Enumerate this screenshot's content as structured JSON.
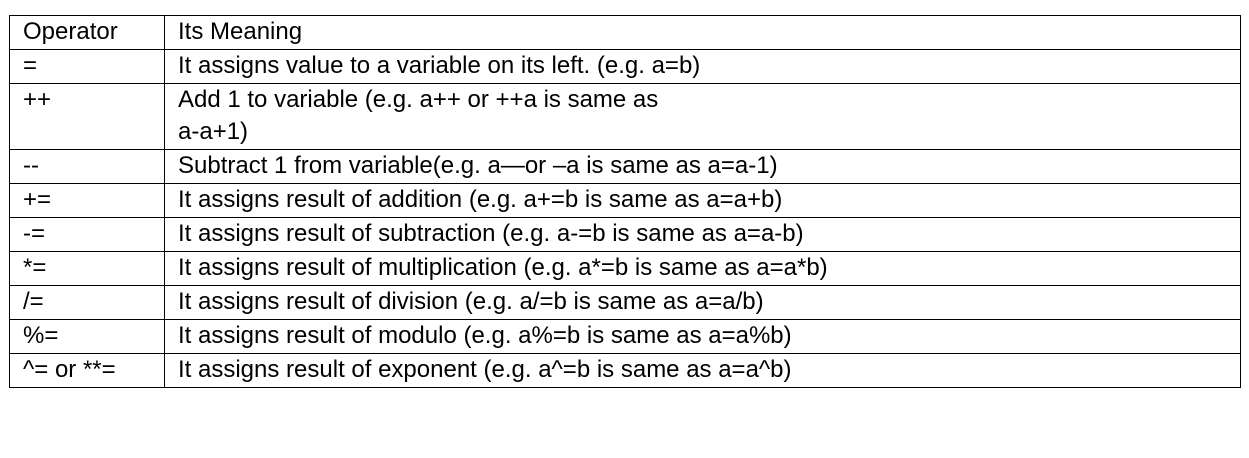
{
  "table": {
    "headers": [
      "Operator",
      "Its Meaning"
    ],
    "rows": [
      {
        "operator": "=",
        "meaning": [
          "It assigns value to a variable on its left. (e.g. a=b)"
        ]
      },
      {
        "operator": "++",
        "meaning": [
          "Add 1 to variable (e.g. a++ or ++a is same as",
          "a-a+1)"
        ]
      },
      {
        "operator": "--",
        "meaning": [
          "Subtract 1 from variable(e.g. a—or –a is same as a=a-1)"
        ]
      },
      {
        "operator": "+=",
        "meaning": [
          "It assigns result of addition (e.g. a+=b is same as a=a+b)"
        ]
      },
      {
        "operator": "-=",
        "meaning": [
          "It assigns result of subtraction (e.g. a-=b is same as a=a-b)"
        ]
      },
      {
        "operator": "*=",
        "meaning": [
          "It assigns result of multiplication (e.g. a*=b is same as a=a*b)"
        ]
      },
      {
        "operator": "/=",
        "meaning": [
          "It assigns result of division (e.g. a/=b is same as a=a/b)"
        ]
      },
      {
        "operator": "%=",
        "meaning": [
          "It assigns result of modulo (e.g. a%=b is same as a=a%b)"
        ]
      },
      {
        "operator": "^= or **=",
        "meaning": [
          "It assigns result of exponent (e.g. a^=b is same as a=a^b)"
        ]
      }
    ]
  }
}
